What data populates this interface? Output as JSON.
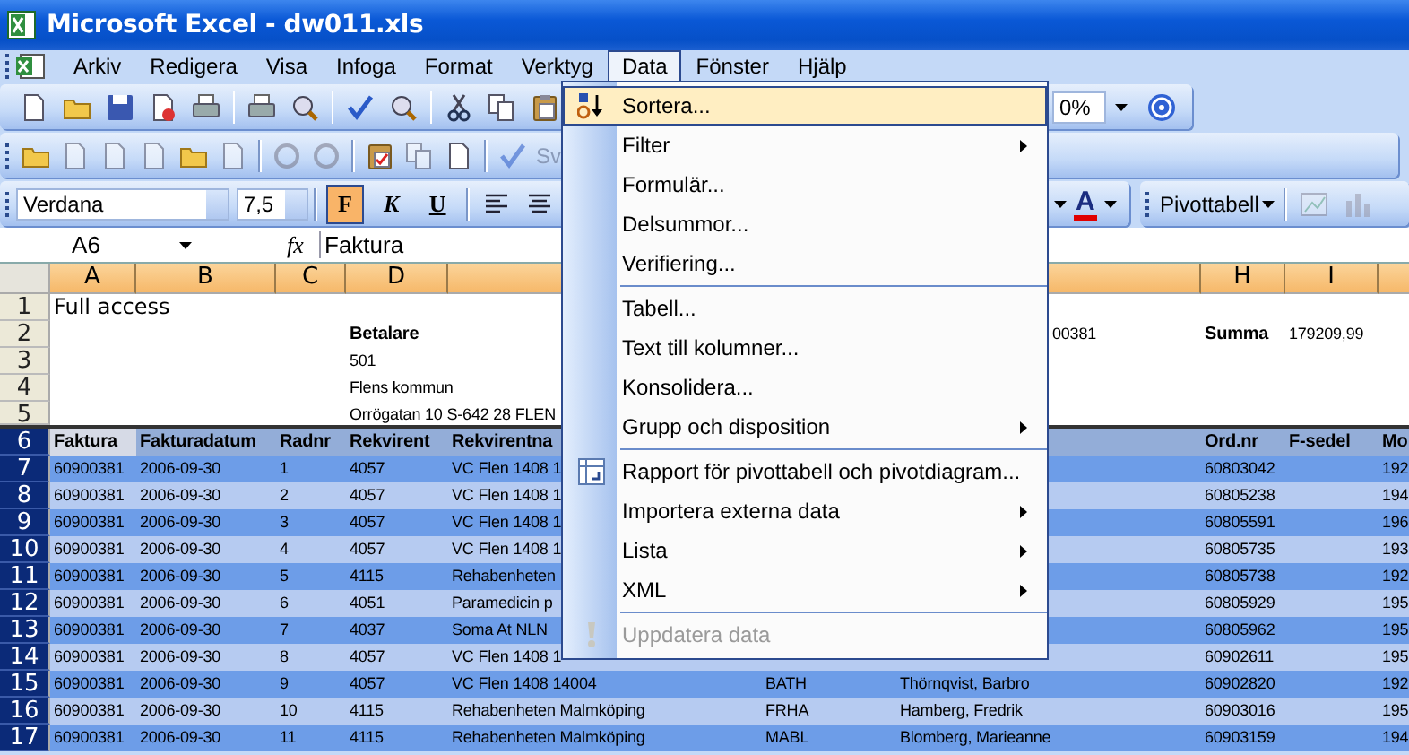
{
  "window": {
    "title": "Microsoft Excel - dw011.xls"
  },
  "menu_bar": [
    {
      "label": "Arkiv",
      "selected": false
    },
    {
      "label": "Redigera",
      "selected": false
    },
    {
      "label": "Visa",
      "selected": false
    },
    {
      "label": "Infoga",
      "selected": false
    },
    {
      "label": "Format",
      "selected": false
    },
    {
      "label": "Verktyg",
      "selected": false
    },
    {
      "label": "Data",
      "selected": true
    },
    {
      "label": "Fönster",
      "selected": false
    },
    {
      "label": "Hjälp",
      "selected": false
    }
  ],
  "standard_toolbar": {
    "zoom": "0%"
  },
  "review_toolbar": {
    "reply_label": "Sv"
  },
  "formatting_toolbar": {
    "font": "Verdana",
    "size": "7,5",
    "buttons": [
      {
        "label": "F",
        "kind": "bold",
        "on": true
      },
      {
        "label": "K",
        "kind": "italic",
        "on": false
      },
      {
        "label": "U",
        "kind": "underline",
        "on": false
      }
    ],
    "font_color": "A",
    "pivot_label": "Pivottabell"
  },
  "formula_bar": {
    "name_box": "A6",
    "function_label": "fx",
    "value": "Faktura"
  },
  "columns": [
    {
      "label": "A",
      "highlighted": true
    },
    {
      "label": "B",
      "highlighted": true
    },
    {
      "label": "C",
      "highlighted": true
    },
    {
      "label": "D",
      "highlighted": true
    },
    {
      "highlighted": true
    },
    {},
    {
      "highlighted": true
    },
    {
      "label": "H",
      "highlighted": true
    },
    {
      "label": "I",
      "highlighted": true
    },
    {
      "highlighted": true
    }
  ],
  "rows": [
    {
      "number": "1",
      "selected": false,
      "kind": "plain",
      "cells": [
        {
          "text": "Full access",
          "kind": "title"
        }
      ]
    },
    {
      "number": "2",
      "selected": false,
      "kind": "plain",
      "cells": [
        null,
        null,
        null,
        {
          "text": "Betalare",
          "bold": true
        },
        null,
        null,
        {
          "text": "00381",
          "kind": "cut"
        },
        {
          "text": "Summa",
          "bold": true
        },
        {
          "text": "179209,99"
        }
      ]
    },
    {
      "number": "3",
      "selected": false,
      "kind": "plain",
      "cells": [
        null,
        null,
        null,
        "501"
      ]
    },
    {
      "number": "4",
      "selected": false,
      "kind": "plain",
      "cells": [
        null,
        null,
        null,
        "Flens kommun"
      ]
    },
    {
      "number": "5",
      "selected": false,
      "kind": "plain",
      "cells": [
        null,
        null,
        null,
        "Orrögatan 10 S-642 28 FLEN"
      ]
    },
    {
      "number": "6",
      "selected": true,
      "kind": "header",
      "cells": [
        {
          "text": "Faktura",
          "active": true
        },
        "Fakturadatum",
        "Radnr",
        "Rekvirent",
        "Rekvirentna",
        null,
        null,
        "Ord.nr",
        "F-sedel",
        "Mo"
      ]
    },
    {
      "number": "7",
      "selected": true,
      "kind": "dark",
      "cells": [
        "60900381",
        "2006-09-30",
        "1",
        "4057",
        "VC Flen 1408 1",
        null,
        null,
        "60803042",
        null,
        "192"
      ]
    },
    {
      "number": "8",
      "selected": true,
      "kind": "light",
      "cells": [
        "60900381",
        "2006-09-30",
        "2",
        "4057",
        "VC Flen 1408 1",
        null,
        null,
        "60805238",
        null,
        "194"
      ]
    },
    {
      "number": "9",
      "selected": true,
      "kind": "dark",
      "cells": [
        "60900381",
        "2006-09-30",
        "3",
        "4057",
        "VC Flen 1408 1",
        null,
        null,
        "60805591",
        null,
        "196"
      ]
    },
    {
      "number": "10",
      "selected": true,
      "kind": "light",
      "cells": [
        "60900381",
        "2006-09-30",
        "4",
        "4057",
        "VC Flen 1408 1",
        null,
        null,
        "60805735",
        null,
        "193"
      ]
    },
    {
      "number": "11",
      "selected": true,
      "kind": "dark",
      "cells": [
        "60900381",
        "2006-09-30",
        "5",
        "4115",
        "Rehabenheten",
        null,
        null,
        "60805738",
        null,
        "192"
      ]
    },
    {
      "number": "12",
      "selected": true,
      "kind": "light",
      "cells": [
        "60900381",
        "2006-09-30",
        "6",
        "4051",
        "Paramedicin p",
        null,
        null,
        "60805929",
        null,
        "195"
      ]
    },
    {
      "number": "13",
      "selected": true,
      "kind": "dark",
      "cells": [
        "60900381",
        "2006-09-30",
        "7",
        "4037",
        "Soma At NLN",
        null,
        null,
        "60805962",
        null,
        "195"
      ]
    },
    {
      "number": "14",
      "selected": true,
      "kind": "light",
      "cells": [
        "60900381",
        "2006-09-30",
        "8",
        "4057",
        "VC Flen 1408 1",
        null,
        null,
        "60902611",
        null,
        "195"
      ]
    },
    {
      "number": "15",
      "selected": true,
      "kind": "dark",
      "cells": [
        "60900381",
        "2006-09-30",
        "9",
        "4057",
        "VC Flen 1408 14004",
        "BATH",
        "Thörnqvist, Barbro",
        "60902820",
        null,
        "192"
      ]
    },
    {
      "number": "16",
      "selected": true,
      "kind": "light",
      "cells": [
        "60900381",
        "2006-09-30",
        "10",
        "4115",
        "Rehabenheten Malmköping",
        "FRHA",
        "Hamberg, Fredrik",
        "60903016",
        null,
        "195"
      ]
    },
    {
      "number": "17",
      "selected": true,
      "kind": "dark",
      "cells": [
        "60900381",
        "2006-09-30",
        "11",
        "4115",
        "Rehabenheten Malmköping",
        "MABL",
        "Blomberg, Marieanne",
        "60903159",
        null,
        "194"
      ]
    }
  ],
  "data_menu": [
    {
      "kind": "item",
      "label": "Sortera...",
      "highlighted": true,
      "disabled": false,
      "submenu": false
    },
    {
      "kind": "item",
      "label": "Filter",
      "highlighted": false,
      "disabled": false,
      "submenu": true
    },
    {
      "kind": "item",
      "label": "Formulär...",
      "highlighted": false,
      "disabled": false,
      "submenu": false
    },
    {
      "kind": "item",
      "label": "Delsummor...",
      "highlighted": false,
      "disabled": false,
      "submenu": false
    },
    {
      "kind": "item",
      "label": "Verifiering...",
      "highlighted": false,
      "disabled": false,
      "submenu": false
    },
    {
      "kind": "separator"
    },
    {
      "kind": "item",
      "label": "Tabell...",
      "highlighted": false,
      "disabled": false,
      "submenu": false
    },
    {
      "kind": "item",
      "label": "Text till kolumner...",
      "highlighted": false,
      "disabled": false,
      "submenu": false
    },
    {
      "kind": "item",
      "label": "Konsolidera...",
      "highlighted": false,
      "disabled": false,
      "submenu": false
    },
    {
      "kind": "item",
      "label": "Grupp och disposition",
      "highlighted": false,
      "disabled": false,
      "submenu": true
    },
    {
      "kind": "separator"
    },
    {
      "kind": "item",
      "label": "Rapport för pivottabell och pivotdiagram...",
      "highlighted": false,
      "disabled": false,
      "submenu": false
    },
    {
      "kind": "item",
      "label": "Importera externa data",
      "highlighted": false,
      "disabled": false,
      "submenu": true
    },
    {
      "kind": "item",
      "label": "Lista",
      "highlighted": false,
      "disabled": false,
      "submenu": true
    },
    {
      "kind": "item",
      "label": "XML",
      "highlighted": false,
      "disabled": false,
      "submenu": true
    },
    {
      "kind": "separator"
    },
    {
      "kind": "item",
      "label": "Uppdatera data",
      "highlighted": false,
      "disabled": true,
      "submenu": false
    }
  ]
}
